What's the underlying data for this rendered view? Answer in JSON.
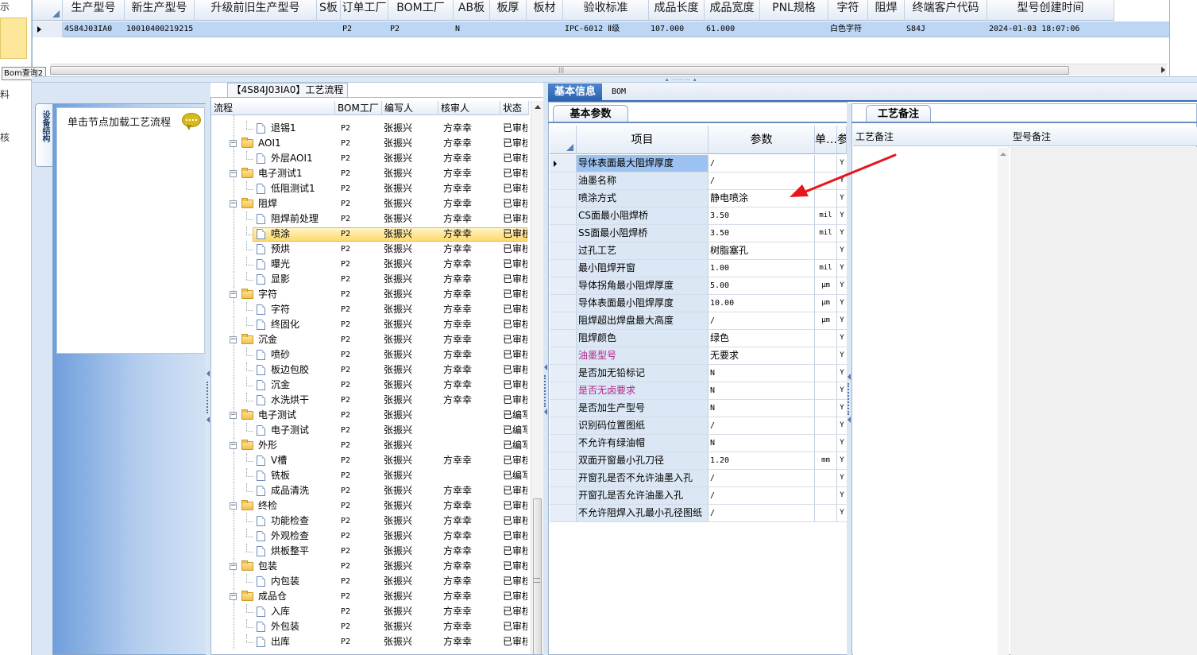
{
  "left_strip": {
    "chars": [
      "示",
      "料",
      "核"
    ]
  },
  "bom_tab": "Bom查询2",
  "top_grid": {
    "headers": [
      "生产型号",
      "新生产型号",
      "升级前旧生产型号",
      "S板",
      "订单工厂",
      "BOM工厂",
      "AB板",
      "板厚",
      "板材",
      "验收标准",
      "成品长度",
      "成品宽度",
      "PNL规格",
      "字符",
      "阻焊",
      "终端客户代码",
      "型号创建时间"
    ],
    "row": [
      "4S84J03IA0",
      "10010400219215",
      "",
      "",
      "P2",
      "P2",
      "N",
      "",
      "",
      "IPC-6012 Ⅱ级",
      "107.000",
      "61.000",
      "",
      "白色字符",
      "",
      "S84J",
      "2024-01-03 18:07:06"
    ]
  },
  "left_panel": {
    "vtab": "设备结构",
    "hint": "单击节点加载工艺流程"
  },
  "tree": {
    "title": "【4S84J03IA0】工艺流程",
    "headers": [
      "流程",
      "BOM工厂",
      "编写人",
      "核审人",
      "状态"
    ],
    "rows": [
      {
        "name": "退锡1",
        "level": 2,
        "factory": "P2",
        "writer": "张振兴",
        "reviewer": "方幸幸",
        "status": "已审核"
      },
      {
        "name": "AOI1",
        "level": 1,
        "factory": "P2",
        "writer": "张振兴",
        "reviewer": "方幸幸",
        "status": "已审核"
      },
      {
        "name": "外层AOI1",
        "level": 2,
        "factory": "P2",
        "writer": "张振兴",
        "reviewer": "方幸幸",
        "status": "已审核"
      },
      {
        "name": "电子测试1",
        "level": 1,
        "factory": "P2",
        "writer": "张振兴",
        "reviewer": "方幸幸",
        "status": "已审核"
      },
      {
        "name": "低阻测试1",
        "level": 2,
        "factory": "P2",
        "writer": "张振兴",
        "reviewer": "方幸幸",
        "status": "已审核"
      },
      {
        "name": "阻焊",
        "level": 1,
        "factory": "P2",
        "writer": "张振兴",
        "reviewer": "方幸幸",
        "status": "已审核"
      },
      {
        "name": "阻焊前处理",
        "level": 2,
        "factory": "P2",
        "writer": "张振兴",
        "reviewer": "方幸幸",
        "status": "已审核"
      },
      {
        "name": "喷涂",
        "level": 2,
        "factory": "P2",
        "writer": "张振兴",
        "reviewer": "方幸幸",
        "status": "已审核",
        "selected": true
      },
      {
        "name": "预烘",
        "level": 2,
        "factory": "P2",
        "writer": "张振兴",
        "reviewer": "方幸幸",
        "status": "已审核"
      },
      {
        "name": "曝光",
        "level": 2,
        "factory": "P2",
        "writer": "张振兴",
        "reviewer": "方幸幸",
        "status": "已审核"
      },
      {
        "name": "显影",
        "level": 2,
        "factory": "P2",
        "writer": "张振兴",
        "reviewer": "方幸幸",
        "status": "已审核"
      },
      {
        "name": "字符",
        "level": 1,
        "factory": "P2",
        "writer": "张振兴",
        "reviewer": "方幸幸",
        "status": "已审核"
      },
      {
        "name": "字符",
        "level": 2,
        "factory": "P2",
        "writer": "张振兴",
        "reviewer": "方幸幸",
        "status": "已审核"
      },
      {
        "name": "终固化",
        "level": 2,
        "factory": "P2",
        "writer": "张振兴",
        "reviewer": "方幸幸",
        "status": "已审核"
      },
      {
        "name": "沉金",
        "level": 1,
        "factory": "P2",
        "writer": "张振兴",
        "reviewer": "方幸幸",
        "status": "已审核"
      },
      {
        "name": "喷砂",
        "level": 2,
        "factory": "P2",
        "writer": "张振兴",
        "reviewer": "方幸幸",
        "status": "已审核"
      },
      {
        "name": "板边包胶",
        "level": 2,
        "factory": "P2",
        "writer": "张振兴",
        "reviewer": "方幸幸",
        "status": "已审核"
      },
      {
        "name": "沉金",
        "level": 2,
        "factory": "P2",
        "writer": "张振兴",
        "reviewer": "方幸幸",
        "status": "已审核"
      },
      {
        "name": "水洗烘干",
        "level": 2,
        "factory": "P2",
        "writer": "张振兴",
        "reviewer": "方幸幸",
        "status": "已审核"
      },
      {
        "name": "电子测试",
        "level": 1,
        "factory": "P2",
        "writer": "张振兴",
        "reviewer": "",
        "status": "已编写"
      },
      {
        "name": "电子测试",
        "level": 2,
        "factory": "P2",
        "writer": "张振兴",
        "reviewer": "",
        "status": "已编写"
      },
      {
        "name": "外形",
        "level": 1,
        "factory": "P2",
        "writer": "张振兴",
        "reviewer": "",
        "status": "已编写"
      },
      {
        "name": "V槽",
        "level": 2,
        "factory": "P2",
        "writer": "张振兴",
        "reviewer": "方幸幸",
        "status": "已审核"
      },
      {
        "name": "铣板",
        "level": 2,
        "factory": "P2",
        "writer": "张振兴",
        "reviewer": "",
        "status": "已编写"
      },
      {
        "name": "成品清洗",
        "level": 2,
        "factory": "P2",
        "writer": "张振兴",
        "reviewer": "方幸幸",
        "status": "已审核"
      },
      {
        "name": "终检",
        "level": 1,
        "factory": "P2",
        "writer": "张振兴",
        "reviewer": "方幸幸",
        "status": "已审核"
      },
      {
        "name": "功能检查",
        "level": 2,
        "factory": "P2",
        "writer": "张振兴",
        "reviewer": "方幸幸",
        "status": "已审核"
      },
      {
        "name": "外观检查",
        "level": 2,
        "factory": "P2",
        "writer": "张振兴",
        "reviewer": "方幸幸",
        "status": "已审核"
      },
      {
        "name": "烘板整平",
        "level": 2,
        "factory": "P2",
        "writer": "张振兴",
        "reviewer": "方幸幸",
        "status": "已审核"
      },
      {
        "name": "包装",
        "level": 1,
        "factory": "P2",
        "writer": "张振兴",
        "reviewer": "方幸幸",
        "status": "已审核"
      },
      {
        "name": "内包装",
        "level": 2,
        "factory": "P2",
        "writer": "张振兴",
        "reviewer": "方幸幸",
        "status": "已审核"
      },
      {
        "name": "成品仓",
        "level": 1,
        "factory": "P2",
        "writer": "张振兴",
        "reviewer": "方幸幸",
        "status": "已审核"
      },
      {
        "name": "入库",
        "level": 2,
        "factory": "P2",
        "writer": "张振兴",
        "reviewer": "方幸幸",
        "status": "已审核"
      },
      {
        "name": "外包装",
        "level": 2,
        "factory": "P2",
        "writer": "张振兴",
        "reviewer": "方幸幸",
        "status": "已审核"
      },
      {
        "name": "出库",
        "level": 2,
        "factory": "P2",
        "writer": "张振兴",
        "reviewer": "方幸幸",
        "status": "已审核"
      }
    ]
  },
  "tabs": {
    "basic": "基本信息",
    "bom": "BOM"
  },
  "params_panel": {
    "subtab": "基本参数",
    "headers": [
      "项目",
      "参数",
      "单…",
      "参"
    ],
    "rows": [
      {
        "item": "导体表面最大阻焊厚度",
        "value": "/",
        "unit": "",
        "flag": "Y",
        "highlight": true
      },
      {
        "item": "油墨名称",
        "value": "/",
        "unit": "",
        "flag": "Y"
      },
      {
        "item": "喷涂方式",
        "value": "静电喷涂",
        "unit": "",
        "flag": "Y"
      },
      {
        "item": "CS面最小阻焊桥",
        "value": "3.50",
        "unit": "mil",
        "flag": "Y"
      },
      {
        "item": "SS面最小阻焊桥",
        "value": "3.50",
        "unit": "mil",
        "flag": "Y"
      },
      {
        "item": "过孔工艺",
        "value": "树脂塞孔",
        "unit": "",
        "flag": "Y"
      },
      {
        "item": "最小阻焊开窗",
        "value": "1.00",
        "unit": "mil",
        "flag": "Y"
      },
      {
        "item": "导体拐角最小阻焊厚度",
        "value": "5.00",
        "unit": "μm",
        "flag": "Y"
      },
      {
        "item": "导体表面最小阻焊厚度",
        "value": "10.00",
        "unit": "μm",
        "flag": "Y"
      },
      {
        "item": "阻焊超出焊盘最大高度",
        "value": "/",
        "unit": "μm",
        "flag": "Y"
      },
      {
        "item": "阻焊颜色",
        "value": "绿色",
        "unit": "",
        "flag": "Y"
      },
      {
        "item": "油墨型号",
        "value": "无要求",
        "unit": "",
        "flag": "Y",
        "pink": true
      },
      {
        "item": "是否加无铅标记",
        "value": "N",
        "unit": "",
        "flag": "Y"
      },
      {
        "item": "是否无卤要求",
        "value": "N",
        "unit": "",
        "flag": "Y",
        "pink": true
      },
      {
        "item": "是否加生产型号",
        "value": "N",
        "unit": "",
        "flag": "Y"
      },
      {
        "item": "识别码位置图纸",
        "value": "/",
        "unit": "",
        "flag": "Y"
      },
      {
        "item": "不允许有绿油帽",
        "value": "N",
        "unit": "",
        "flag": "Y"
      },
      {
        "item": "双面开窗最小孔刀径",
        "value": "1.20",
        "unit": "mm",
        "flag": "Y"
      },
      {
        "item": "开窗孔是否不允许油墨入孔",
        "value": "/",
        "unit": "",
        "flag": "Y"
      },
      {
        "item": "开窗孔是否允许油墨入孔",
        "value": "/",
        "unit": "",
        "flag": "Y"
      },
      {
        "item": "不允许阻焊入孔最小孔径图纸",
        "value": "/",
        "unit": "",
        "flag": "Y"
      }
    ]
  },
  "remark_panel": {
    "subtab": "工艺备注",
    "col1": "工艺备注",
    "col2": "型号备注"
  },
  "annotation": {
    "arrow_color": "#e8161b"
  }
}
